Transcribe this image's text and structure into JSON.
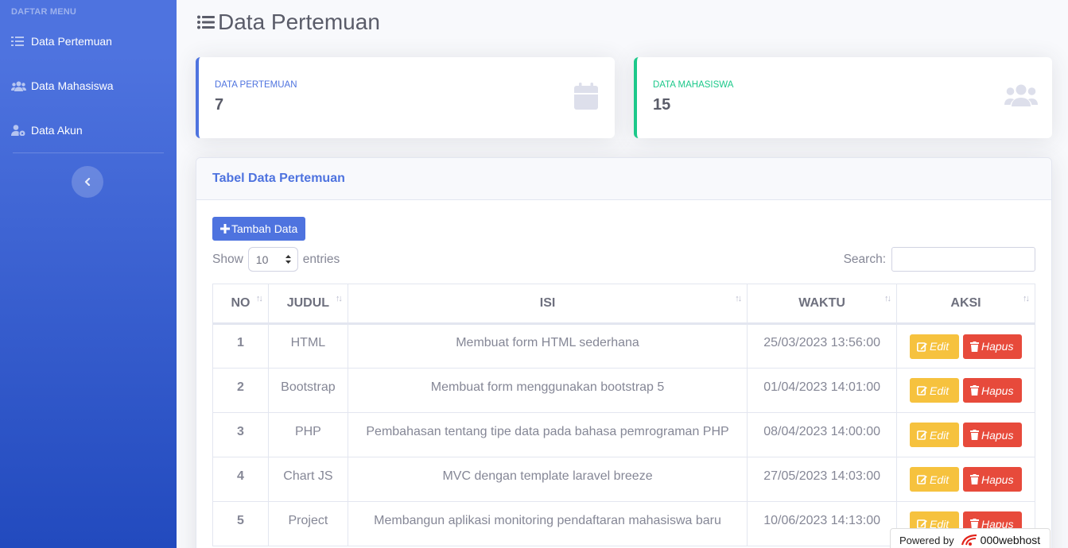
{
  "sidebar": {
    "heading": "DAFTAR MENU",
    "items": [
      {
        "label": "Data Pertemuan",
        "icon": "list-icon"
      },
      {
        "label": "Data Mahasiswa",
        "icon": "users-icon"
      },
      {
        "label": "Data Akun",
        "icon": "user-cog-icon"
      }
    ]
  },
  "page": {
    "title": "Data Pertemuan"
  },
  "stats": [
    {
      "label": "DATA PERTEMUAN",
      "value": "7",
      "color": "#4e73df",
      "icon": "calendar-icon"
    },
    {
      "label": "DATA MAHASISWA",
      "value": "15",
      "color": "#1cc88a",
      "icon": "users-icon"
    }
  ],
  "table_card": {
    "title": "Tabel Data Pertemuan",
    "add_label": "Tambah Data",
    "show_label": "Show",
    "entries_value": "10",
    "entries_label": "entries",
    "search_label": "Search:",
    "search_value": "",
    "columns": [
      "NO",
      "JUDUL",
      "ISI",
      "WAKTU",
      "AKSI"
    ],
    "edit_label": "Edit",
    "delete_label": "Hapus",
    "rows": [
      {
        "no": "1",
        "judul": "HTML",
        "isi": "Membuat form HTML sederhana",
        "waktu": "25/03/2023 13:56:00"
      },
      {
        "no": "2",
        "judul": "Bootstrap",
        "isi": "Membuat form menggunakan bootstrap 5",
        "waktu": "01/04/2023 14:01:00"
      },
      {
        "no": "3",
        "judul": "PHP",
        "isi": "Pembahasan tentang tipe data pada bahasa pemrograman PHP",
        "waktu": "08/04/2023 14:00:00"
      },
      {
        "no": "4",
        "judul": "Chart JS",
        "isi": "MVC dengan template laravel breeze",
        "waktu": "27/05/2023 14:03:00"
      },
      {
        "no": "5",
        "judul": "Project",
        "isi": "Membangun aplikasi monitoring pendaftaran mahasiswa baru",
        "waktu": "10/06/2023 14:13:00"
      }
    ]
  },
  "powered": {
    "prefix": "Powered by",
    "brand": "000webhost"
  }
}
